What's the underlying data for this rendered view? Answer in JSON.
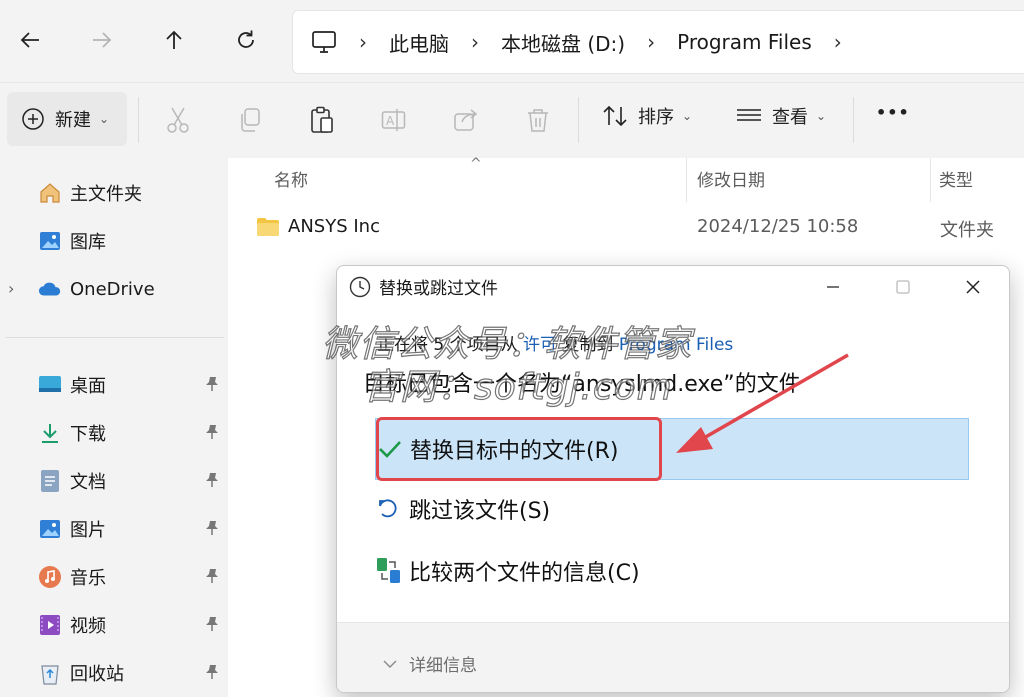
{
  "address": {
    "crumbs": [
      "此电脑",
      "本地磁盘 (D:)",
      "Program Files"
    ]
  },
  "toolbar": {
    "new_label": "新建",
    "sort_label": "排序",
    "view_label": "查看",
    "more_label": "•••"
  },
  "sidebar": {
    "top": [
      {
        "label": "主文件夹",
        "icon": "home-icon"
      },
      {
        "label": "图库",
        "icon": "gallery-icon"
      },
      {
        "label": "OneDrive",
        "icon": "cloud-icon"
      }
    ],
    "pinned": [
      {
        "label": "桌面",
        "icon": "desktop-icon"
      },
      {
        "label": "下载",
        "icon": "download-icon"
      },
      {
        "label": "文档",
        "icon": "document-icon"
      },
      {
        "label": "图片",
        "icon": "pictures-icon"
      },
      {
        "label": "音乐",
        "icon": "music-icon"
      },
      {
        "label": "视频",
        "icon": "video-icon"
      },
      {
        "label": "回收站",
        "icon": "recycle-bin-icon"
      }
    ]
  },
  "files": {
    "columns": [
      "名称",
      "修改日期",
      "类型"
    ],
    "rows": [
      {
        "name": "ANSYS Inc",
        "date": "2024/12/25 10:58",
        "type": "文件夹"
      }
    ]
  },
  "dialog": {
    "title": "替换或跳过文件",
    "line1_prefix": "正在将 5 个项目从 ",
    "line1_source": "许可",
    "line1_middle": " 复制到 ",
    "line1_dest": "Program Files",
    "line2": "目标已包含一个名为“ansyslmd.exe”的文件",
    "option_replace": "替换目标中的文件(R)",
    "option_skip": "跳过该文件(S)",
    "option_compare": "比较两个文件的信息(C)",
    "details_label": "详细信息"
  },
  "watermark": {
    "line1": "微信公众号：软件管家",
    "line2": "官网：softgj.com"
  },
  "colors": {
    "selection": "#cce4f7",
    "highlight_box": "#e0464c",
    "arrow": "#e0464c",
    "link": "#1a5fb4"
  }
}
